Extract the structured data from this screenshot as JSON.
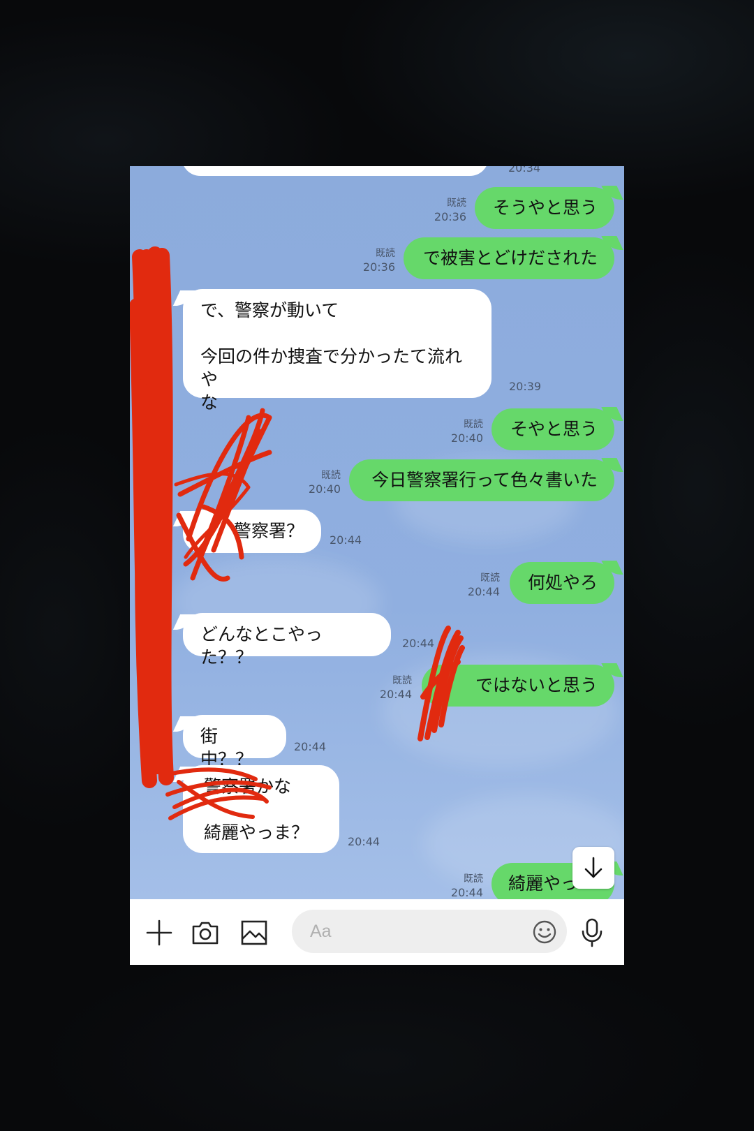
{
  "colors": {
    "chat_background": "#8eaede",
    "outgoing_bubble": "#66d86a",
    "incoming_bubble": "#ffffff",
    "redaction_marker": "#e12a0f"
  },
  "chat": {
    "top_cut_time": "20:34",
    "messages": [
      {
        "dir": "out",
        "text": "そうやと思う",
        "read": "既読",
        "time": "20:36"
      },
      {
        "dir": "out",
        "text": "で被害とどけだされた",
        "read": "既読",
        "time": "20:36"
      },
      {
        "dir": "in",
        "text": "で、警察が動いて\n\n今回の件か捜査で分かったて流れや\nな",
        "time": "20:39"
      },
      {
        "dir": "out",
        "text": "そやと思う",
        "read": "既読",
        "time": "20:40"
      },
      {
        "dir": "out",
        "text": "今日警察署行って色々書いた",
        "read": "既読",
        "time": "20:40"
      },
      {
        "dir": "in",
        "text": "警察署？",
        "time": "20:44"
      },
      {
        "dir": "out",
        "text": "何処やろ",
        "read": "既読",
        "time": "20:44"
      },
      {
        "dir": "in",
        "text": "どんなとこやった？？",
        "time": "20:44"
      },
      {
        "dir": "out",
        "text": "ではないと思う",
        "read": "既読",
        "time": "20:44"
      },
      {
        "dir": "in",
        "text": "街中？？",
        "time": "20:44"
      },
      {
        "dir": "in",
        "text": "警察署かな\n\n綺麗やっま？",
        "time": "20:44"
      },
      {
        "dir": "out",
        "text": "綺麗やっ",
        "read": "既読",
        "time": "20:44"
      }
    ]
  },
  "input_bar": {
    "icons": [
      "plus-icon",
      "camera-icon",
      "image-icon",
      "emoji-icon",
      "microphone-icon"
    ],
    "placeholder": "Aa",
    "scroll_down_icon": "arrow-down-icon"
  }
}
